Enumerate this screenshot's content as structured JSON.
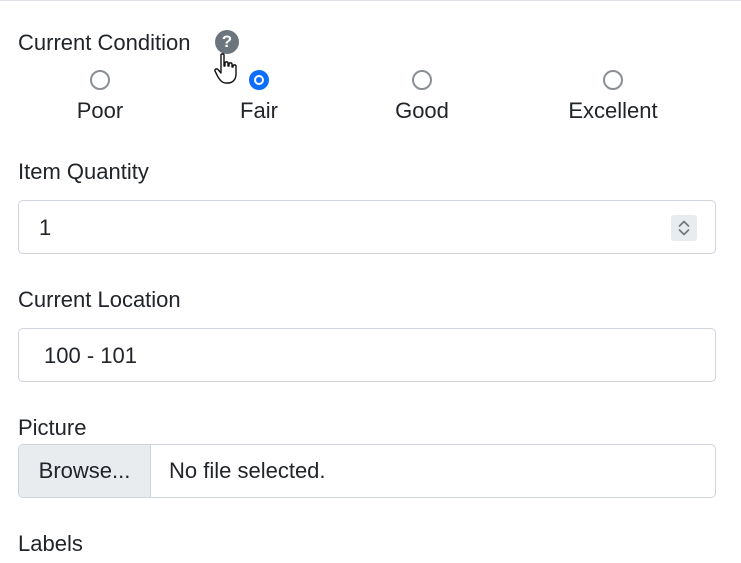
{
  "condition": {
    "label": "Current Condition",
    "help_icon": "?",
    "options": [
      {
        "label": "Poor",
        "checked": false
      },
      {
        "label": "Fair",
        "checked": true
      },
      {
        "label": "Good",
        "checked": false
      },
      {
        "label": "Excellent",
        "checked": false
      }
    ],
    "selected": "Fair"
  },
  "quantity": {
    "label": "Item Quantity",
    "value": "1"
  },
  "location": {
    "label": "Current Location",
    "value": "100 - 101"
  },
  "picture": {
    "label": "Picture",
    "browse_label": "Browse...",
    "status": "No file selected."
  },
  "labels": {
    "label": "Labels"
  },
  "colors": {
    "accent": "#0d6efd",
    "help_icon": "#6c757d",
    "border": "#ced4da"
  },
  "icons": {
    "help": "question-circle-icon",
    "cursor": "hand-pointer-icon",
    "spinner": "up-down-chevron-icon"
  }
}
